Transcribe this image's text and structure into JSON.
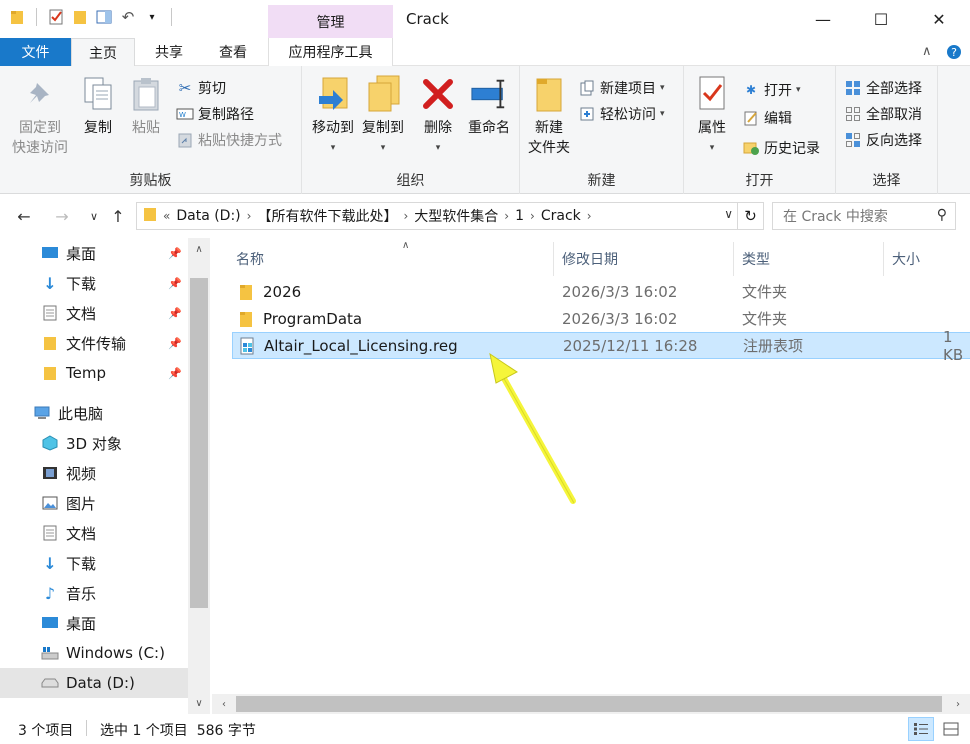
{
  "window": {
    "title": "Crack",
    "manage_tab": "管理",
    "minimize_glyph": "—",
    "maximize_glyph": "☐",
    "close_glyph": "✕"
  },
  "tabs": {
    "file": "文件",
    "home": "主页",
    "share": "共享",
    "view": "查看",
    "app_tools": "应用程序工具"
  },
  "ribbon": {
    "clipboard": {
      "label": "剪贴板",
      "pin_quick": "固定到\n快速访问",
      "copy": "复制",
      "paste": "粘贴",
      "cut": "剪切",
      "copy_path": "复制路径",
      "paste_shortcut": "粘贴快捷方式"
    },
    "organize": {
      "label": "组织",
      "move_to": "移动到",
      "copy_to": "复制到",
      "delete": "删除",
      "rename": "重命名"
    },
    "new": {
      "label": "新建",
      "new_folder": "新建\n文件夹",
      "new_item": "新建项目",
      "easy_access": "轻松访问"
    },
    "open": {
      "label": "打开",
      "properties": "属性",
      "open": "打开",
      "edit": "编辑",
      "history": "历史记录"
    },
    "select": {
      "label": "选择",
      "select_all": "全部选择",
      "select_none": "全部取消",
      "invert": "反向选择"
    }
  },
  "address": {
    "prefix": "«",
    "crumbs": [
      "Data (D:)",
      "【所有软件下载此处】",
      "大型软件集合",
      "1",
      "Crack"
    ],
    "search_placeholder": "在 Crack 中搜索"
  },
  "sidebar": {
    "quick": [
      {
        "label": "桌面",
        "icon": "desktop-icon"
      },
      {
        "label": "下载",
        "icon": "download-icon"
      },
      {
        "label": "文档",
        "icon": "document-icon"
      },
      {
        "label": "文件传输",
        "icon": "folder-icon"
      },
      {
        "label": "Temp",
        "icon": "folder-icon"
      }
    ],
    "this_pc": "此电脑",
    "pc_items": [
      {
        "label": "3D 对象",
        "icon": "3d-objects-icon"
      },
      {
        "label": "视频",
        "icon": "video-icon"
      },
      {
        "label": "图片",
        "icon": "picture-icon"
      },
      {
        "label": "文档",
        "icon": "document-icon"
      },
      {
        "label": "下载",
        "icon": "download-icon"
      },
      {
        "label": "音乐",
        "icon": "music-icon"
      },
      {
        "label": "桌面",
        "icon": "desktop-icon"
      },
      {
        "label": "Windows (C:)",
        "icon": "windows-drive-icon"
      },
      {
        "label": "Data (D:)",
        "icon": "drive-icon"
      }
    ]
  },
  "columns": {
    "name": "名称",
    "date": "修改日期",
    "type": "类型",
    "size": "大小"
  },
  "files": [
    {
      "name": "2026",
      "date": "2026/3/3 16:02",
      "type": "文件夹",
      "size": "",
      "kind": "folder"
    },
    {
      "name": "ProgramData",
      "date": "2026/3/3 16:02",
      "type": "文件夹",
      "size": "",
      "kind": "folder"
    },
    {
      "name": "Altair_Local_Licensing.reg",
      "date": "2025/12/11 16:28",
      "type": "注册表项",
      "size": "1 KB",
      "kind": "reg",
      "selected": true
    }
  ],
  "status": {
    "count": "3 个项目",
    "selected": "选中 1 个项目  586 字节"
  },
  "colors": {
    "accent": "#1979ca",
    "selection": "#cce8ff",
    "manage_tab": "#f1ddf5",
    "arrow": "#f5f53a"
  }
}
